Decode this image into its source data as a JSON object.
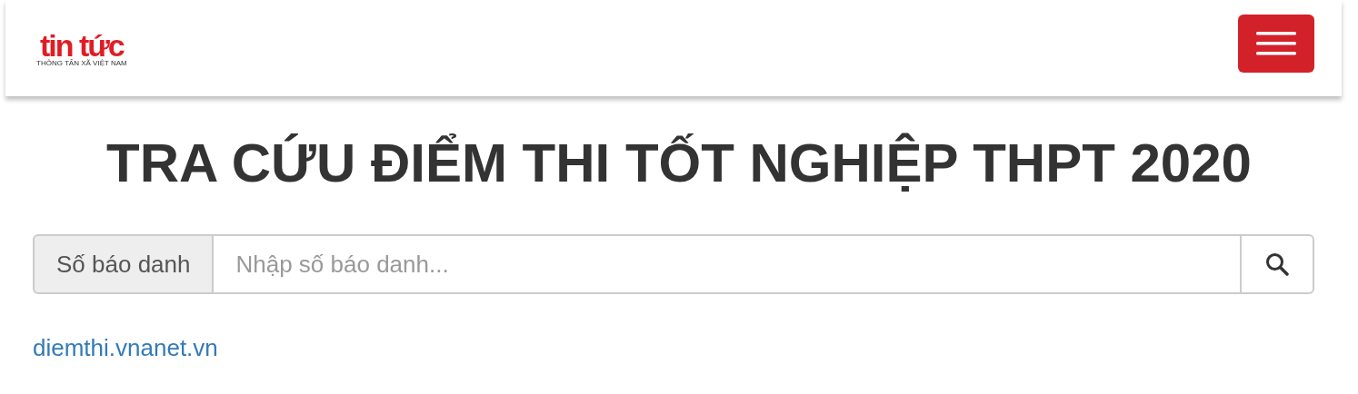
{
  "header": {
    "logo": {
      "name": "tin tức",
      "tagline": "THÔNG TẤN XÃ VIỆT NAM"
    }
  },
  "title": "TRA CỨU ĐIỂM THI TỐT NGHIỆP THPT 2020",
  "search": {
    "label": "Số báo danh",
    "placeholder": "Nhập số báo danh..."
  },
  "link": "diemthi.vnanet.vn"
}
